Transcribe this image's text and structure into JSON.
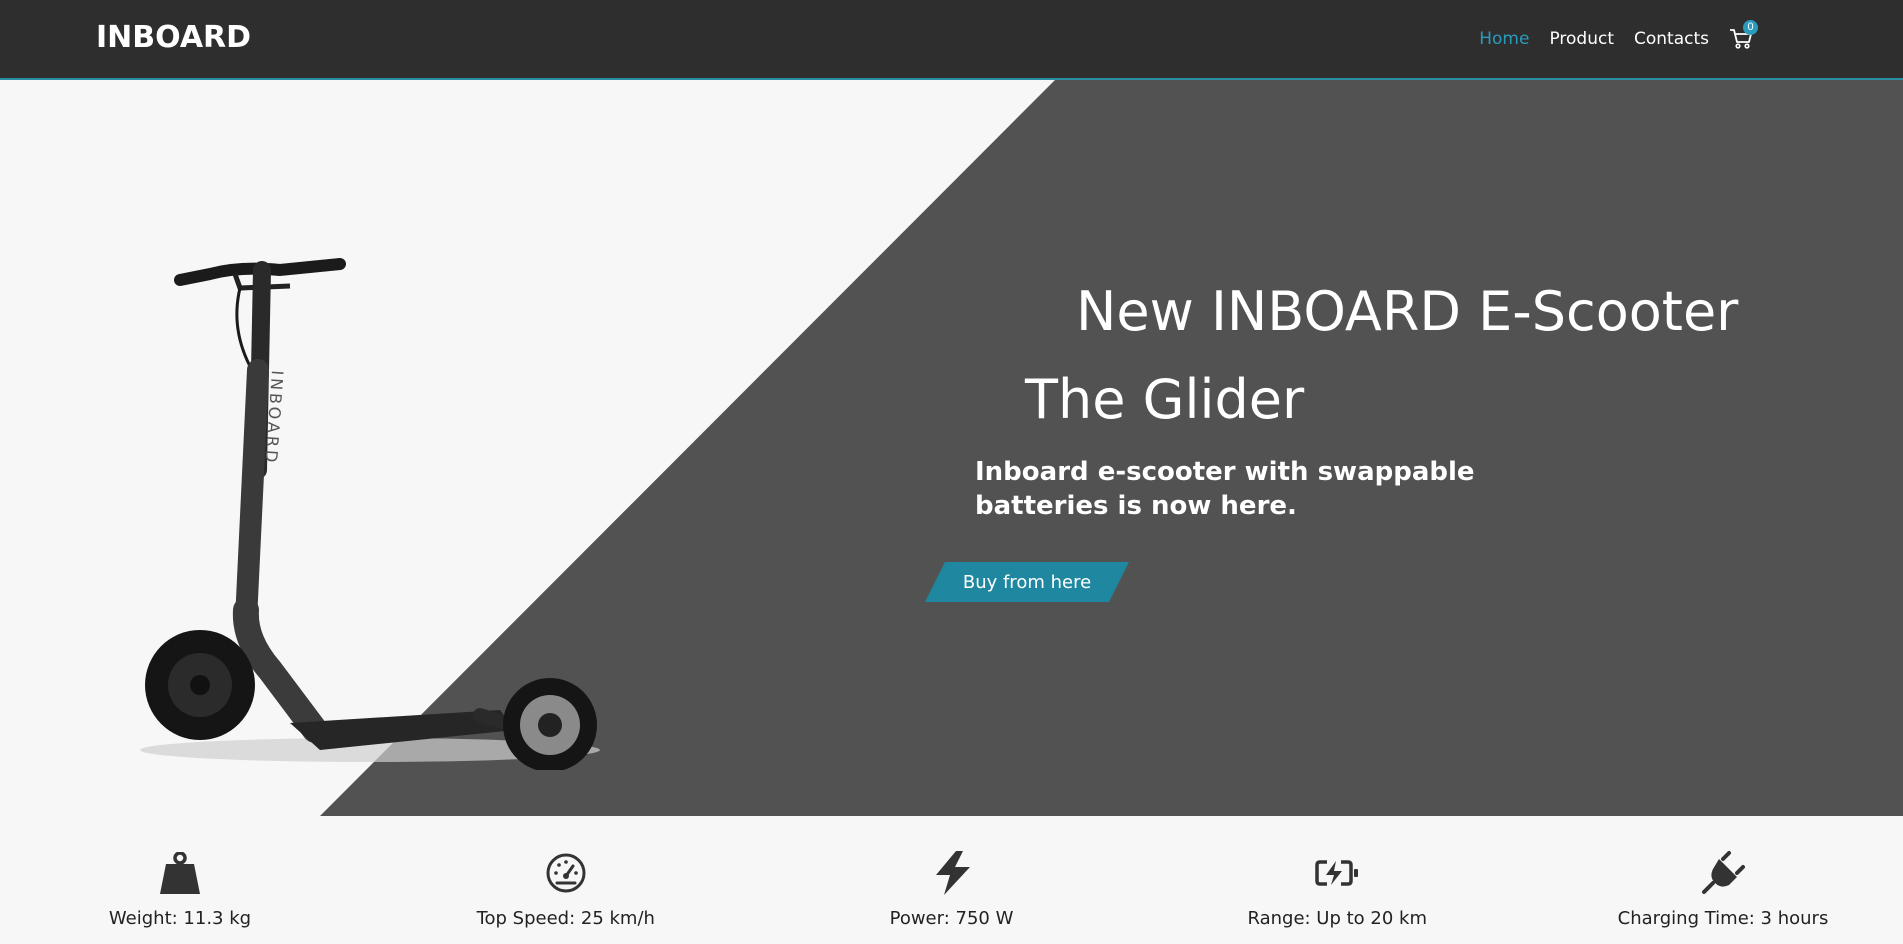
{
  "nav": {
    "brand": "INBOARD",
    "links": [
      {
        "label": "Home",
        "active": true
      },
      {
        "label": "Product",
        "active": false
      },
      {
        "label": "Contacts",
        "active": false
      }
    ],
    "cart_count": "0",
    "cart_icon": "cart-icon"
  },
  "hero": {
    "title": "New INBOARD E-Scooter",
    "subtitle": "The Glider",
    "description": "Inboard e-scooter with swappable batteries is now here.",
    "button_label": "Buy from here",
    "image": "e-scooter-product-image"
  },
  "features": [
    {
      "icon": "weight-icon",
      "label": "Weight: 11.3 kg"
    },
    {
      "icon": "speedometer-icon",
      "label": "Top Speed: 25 km/h"
    },
    {
      "icon": "lightning-bolt-icon",
      "label": "Power: 750 W"
    },
    {
      "icon": "battery-charging-icon",
      "label": "Range: Up to 20 km"
    },
    {
      "icon": "plug-icon",
      "label": "Charging Time: 3 hours"
    }
  ],
  "colors": {
    "navbar": "#2e2e2e",
    "accent": "#2a9bbd",
    "hero_dark": "#525252",
    "hero_light": "#f7f7f7",
    "button": "#1f87a0"
  }
}
